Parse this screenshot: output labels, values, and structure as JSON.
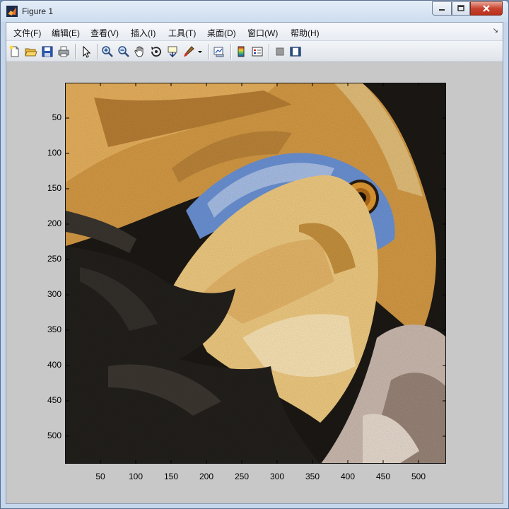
{
  "window": {
    "title": "Figure 1",
    "icon": "matlab-logo-icon",
    "controls": {
      "minimize": "minimize-icon",
      "maximize": "maximize-icon",
      "close": "close-icon"
    }
  },
  "menubar": {
    "items": [
      {
        "label": "文件(F)"
      },
      {
        "label": "编辑(E)"
      },
      {
        "label": "查看(V)"
      },
      {
        "label": "插入(I)"
      },
      {
        "label": "工具(T)"
      },
      {
        "label": "桌面(D)"
      },
      {
        "label": "窗口(W)"
      },
      {
        "label": "帮助(H)"
      }
    ],
    "overflow_icon": "dock-arrow-icon"
  },
  "toolbar": {
    "buttons": [
      "new-figure-icon",
      "open-file-icon",
      "save-figure-icon",
      "print-figure-icon",
      "edit-plot-icon",
      "zoom-in-icon",
      "zoom-out-icon",
      "pan-icon",
      "rotate-3d-icon",
      "data-cursor-icon",
      "brush-icon",
      "brush-dropdown-icon",
      "link-plot-icon",
      "insert-colorbar-icon",
      "insert-legend-icon",
      "hide-plot-tools-icon",
      "show-plot-tools-icon"
    ]
  },
  "axes": {
    "x_ticks": [
      "50",
      "100",
      "150",
      "200",
      "250",
      "300",
      "350",
      "400",
      "450",
      "500"
    ],
    "y_ticks": [
      "50",
      "100",
      "150",
      "200",
      "250",
      "300",
      "350",
      "400",
      "450",
      "500"
    ],
    "image": "bird-image"
  },
  "colors": {
    "figure_bg": "#c8c8c8",
    "bird_orange": "#d9a04a",
    "bird_blue": "#6f96d8",
    "beak": "#f1cc82",
    "feathers_dark": "#23201c"
  }
}
